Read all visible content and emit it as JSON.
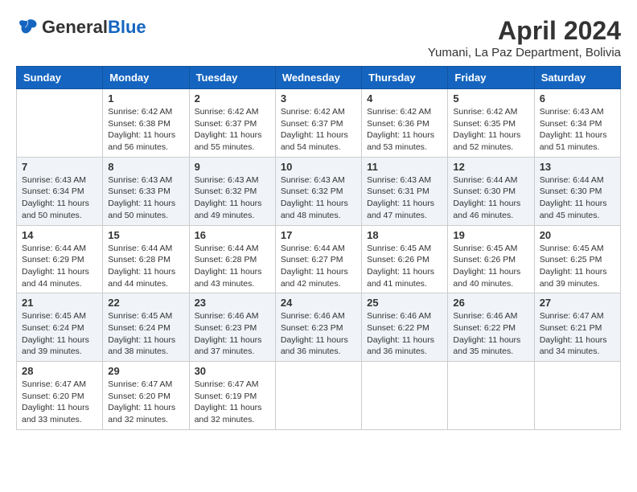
{
  "header": {
    "logo_general": "General",
    "logo_blue": "Blue",
    "month_year": "April 2024",
    "location": "Yumani, La Paz Department, Bolivia"
  },
  "weekdays": [
    "Sunday",
    "Monday",
    "Tuesday",
    "Wednesday",
    "Thursday",
    "Friday",
    "Saturday"
  ],
  "weeks": [
    [
      {
        "day": "",
        "info": ""
      },
      {
        "day": "1",
        "info": "Sunrise: 6:42 AM\nSunset: 6:38 PM\nDaylight: 11 hours\nand 56 minutes."
      },
      {
        "day": "2",
        "info": "Sunrise: 6:42 AM\nSunset: 6:37 PM\nDaylight: 11 hours\nand 55 minutes."
      },
      {
        "day": "3",
        "info": "Sunrise: 6:42 AM\nSunset: 6:37 PM\nDaylight: 11 hours\nand 54 minutes."
      },
      {
        "day": "4",
        "info": "Sunrise: 6:42 AM\nSunset: 6:36 PM\nDaylight: 11 hours\nand 53 minutes."
      },
      {
        "day": "5",
        "info": "Sunrise: 6:42 AM\nSunset: 6:35 PM\nDaylight: 11 hours\nand 52 minutes."
      },
      {
        "day": "6",
        "info": "Sunrise: 6:43 AM\nSunset: 6:34 PM\nDaylight: 11 hours\nand 51 minutes."
      }
    ],
    [
      {
        "day": "7",
        "info": "Sunrise: 6:43 AM\nSunset: 6:34 PM\nDaylight: 11 hours\nand 50 minutes."
      },
      {
        "day": "8",
        "info": "Sunrise: 6:43 AM\nSunset: 6:33 PM\nDaylight: 11 hours\nand 50 minutes."
      },
      {
        "day": "9",
        "info": "Sunrise: 6:43 AM\nSunset: 6:32 PM\nDaylight: 11 hours\nand 49 minutes."
      },
      {
        "day": "10",
        "info": "Sunrise: 6:43 AM\nSunset: 6:32 PM\nDaylight: 11 hours\nand 48 minutes."
      },
      {
        "day": "11",
        "info": "Sunrise: 6:43 AM\nSunset: 6:31 PM\nDaylight: 11 hours\nand 47 minutes."
      },
      {
        "day": "12",
        "info": "Sunrise: 6:44 AM\nSunset: 6:30 PM\nDaylight: 11 hours\nand 46 minutes."
      },
      {
        "day": "13",
        "info": "Sunrise: 6:44 AM\nSunset: 6:30 PM\nDaylight: 11 hours\nand 45 minutes."
      }
    ],
    [
      {
        "day": "14",
        "info": "Sunrise: 6:44 AM\nSunset: 6:29 PM\nDaylight: 11 hours\nand 44 minutes."
      },
      {
        "day": "15",
        "info": "Sunrise: 6:44 AM\nSunset: 6:28 PM\nDaylight: 11 hours\nand 44 minutes."
      },
      {
        "day": "16",
        "info": "Sunrise: 6:44 AM\nSunset: 6:28 PM\nDaylight: 11 hours\nand 43 minutes."
      },
      {
        "day": "17",
        "info": "Sunrise: 6:44 AM\nSunset: 6:27 PM\nDaylight: 11 hours\nand 42 minutes."
      },
      {
        "day": "18",
        "info": "Sunrise: 6:45 AM\nSunset: 6:26 PM\nDaylight: 11 hours\nand 41 minutes."
      },
      {
        "day": "19",
        "info": "Sunrise: 6:45 AM\nSunset: 6:26 PM\nDaylight: 11 hours\nand 40 minutes."
      },
      {
        "day": "20",
        "info": "Sunrise: 6:45 AM\nSunset: 6:25 PM\nDaylight: 11 hours\nand 39 minutes."
      }
    ],
    [
      {
        "day": "21",
        "info": "Sunrise: 6:45 AM\nSunset: 6:24 PM\nDaylight: 11 hours\nand 39 minutes."
      },
      {
        "day": "22",
        "info": "Sunrise: 6:45 AM\nSunset: 6:24 PM\nDaylight: 11 hours\nand 38 minutes."
      },
      {
        "day": "23",
        "info": "Sunrise: 6:46 AM\nSunset: 6:23 PM\nDaylight: 11 hours\nand 37 minutes."
      },
      {
        "day": "24",
        "info": "Sunrise: 6:46 AM\nSunset: 6:23 PM\nDaylight: 11 hours\nand 36 minutes."
      },
      {
        "day": "25",
        "info": "Sunrise: 6:46 AM\nSunset: 6:22 PM\nDaylight: 11 hours\nand 36 minutes."
      },
      {
        "day": "26",
        "info": "Sunrise: 6:46 AM\nSunset: 6:22 PM\nDaylight: 11 hours\nand 35 minutes."
      },
      {
        "day": "27",
        "info": "Sunrise: 6:47 AM\nSunset: 6:21 PM\nDaylight: 11 hours\nand 34 minutes."
      }
    ],
    [
      {
        "day": "28",
        "info": "Sunrise: 6:47 AM\nSunset: 6:20 PM\nDaylight: 11 hours\nand 33 minutes."
      },
      {
        "day": "29",
        "info": "Sunrise: 6:47 AM\nSunset: 6:20 PM\nDaylight: 11 hours\nand 32 minutes."
      },
      {
        "day": "30",
        "info": "Sunrise: 6:47 AM\nSunset: 6:19 PM\nDaylight: 11 hours\nand 32 minutes."
      },
      {
        "day": "",
        "info": ""
      },
      {
        "day": "",
        "info": ""
      },
      {
        "day": "",
        "info": ""
      },
      {
        "day": "",
        "info": ""
      }
    ]
  ]
}
